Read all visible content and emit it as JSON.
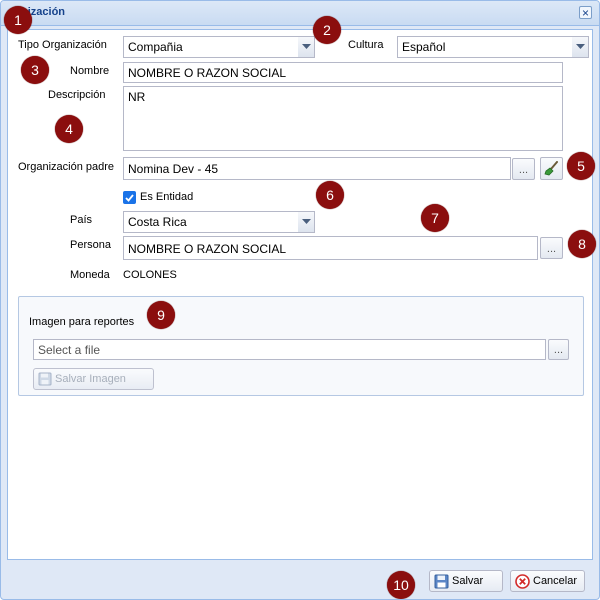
{
  "window": {
    "title": "nización",
    "close_symbol": "×"
  },
  "form": {
    "tipo_organizacion_label": "Tipo Organización",
    "tipo_organizacion_value": "Compañia",
    "cultura_label": "Cultura",
    "cultura_value": "Español",
    "nombre_label": "Nombre",
    "nombre_value": "NOMBRE O RAZON SOCIAL",
    "descripcion_label": "Descripción",
    "descripcion_value": "NR",
    "org_padre_label": "Organización padre",
    "org_padre_value": "Nomina Dev - 45",
    "es_entidad_label": "Es Entidad",
    "es_entidad_checked": true,
    "pais_label": "País",
    "pais_value": "Costa Rica",
    "persona_label": "Persona",
    "persona_value": "NOMBRE O RAZON SOCIAL",
    "moneda_label": "Moneda",
    "moneda_value": "COLONES",
    "browse_label": "..."
  },
  "imagen": {
    "section_label": "Imagen para reportes",
    "file_placeholder": "Select a file",
    "browse_label": "...",
    "save_image_label": "Salvar Imagen"
  },
  "footer": {
    "save_label": "Salvar",
    "cancel_label": "Cancelar"
  },
  "markers": [
    "1",
    "2",
    "3",
    "4",
    "5",
    "6",
    "7",
    "8",
    "9",
    "10"
  ],
  "colors": {
    "title_text": "#15428b",
    "window_bg": "#dfe8f6",
    "border": "#99bbe8",
    "marker": "#8b0e0e",
    "checkbox": "#1a73e8",
    "brush_green": "#3a9a3a"
  },
  "icons": {
    "close": "close-icon",
    "combo": "chevron-down-icon",
    "clear": "brush-icon",
    "save": "floppy-disk-icon",
    "cancel": "cancel-icon"
  }
}
